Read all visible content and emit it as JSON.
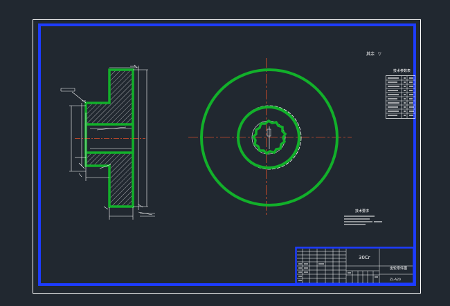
{
  "drawing": {
    "roughness_note": "其余",
    "roughness_symbol": "▽",
    "tech_table_title": "技术参数表",
    "tech_notes_title": "技术要求",
    "material": "30Cr",
    "part_name": "齿轮零件图",
    "drawing_number": "ZL-A20"
  },
  "colors": {
    "background": "#212830",
    "frame_blue": "#1d3cff",
    "gear_green": "#12b02a",
    "centerline": "#e0502a",
    "linework": "#ffffff"
  }
}
